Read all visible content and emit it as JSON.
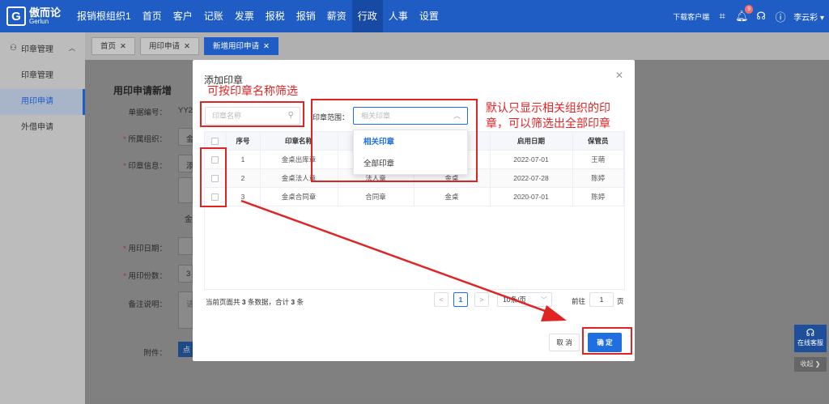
{
  "brand": {
    "logo_mark": "G",
    "name_cn": "傲而论",
    "name_en": "Gerlun"
  },
  "nav": {
    "items": [
      "报销根组织1",
      "首页",
      "客户",
      "记账",
      "发票",
      "报税",
      "报销",
      "薪资",
      "行政",
      "人事",
      "设置"
    ],
    "active": "行政"
  },
  "topbar": {
    "download": "下载客户端",
    "badge": "9",
    "user": "李云彩 ▾"
  },
  "sidebar": {
    "group": "印章管理",
    "items": [
      "印章管理",
      "用印申请",
      "外借申请"
    ],
    "active": "用印申请"
  },
  "tabs": [
    {
      "label": "首页",
      "active": false
    },
    {
      "label": "用印申请",
      "active": false
    },
    {
      "label": "新增用印申请",
      "active": true
    }
  ],
  "form": {
    "title": "用印申请新增",
    "labels": {
      "doc_no": "单据编号：",
      "org": "所属组织：",
      "seal_info": "印章信息：",
      "date": "用印日期：",
      "count": "用印份数：",
      "remark": "备注说明：",
      "attach": "附件："
    },
    "doc_no_value": "YY2",
    "org_value": "金",
    "seal_value": "添",
    "seal_sub": "金",
    "count_value": "3",
    "remark_value": "请",
    "attach_btn": "点"
  },
  "modal": {
    "title": "添加印章",
    "search_placeholder": "印章名称",
    "scope_label": "印章范围：",
    "scope_placeholder": "相关印章",
    "scope_options": [
      "相关印章",
      "全部印章"
    ],
    "scope_selected": "相关印章",
    "table": {
      "headers": [
        "序号",
        "印章名称",
        "",
        "",
        "",
        "启用日期",
        "保管员"
      ],
      "rows": [
        {
          "no": "1",
          "name": "金桌出库章",
          "type": "",
          "org": "",
          "date": "2022-07-01",
          "keeper": "王萌"
        },
        {
          "no": "2",
          "name": "金桌法人章",
          "type": "法人章",
          "org": "金桌",
          "date": "2022-07-28",
          "keeper": "陈婷"
        },
        {
          "no": "3",
          "name": "金桌合同章",
          "type": "合同章",
          "org": "金桌",
          "date": "2020-07-01",
          "keeper": "陈婷"
        }
      ]
    },
    "pager": {
      "prefix": "当前页面共",
      "count1": "3",
      "mid": "条数据，合计",
      "count2": "3",
      "suffix": "条",
      "prev": "<",
      "current": "1",
      "next": ">",
      "page_size": "10条/页",
      "goto_label": "前往",
      "goto_value": "1",
      "goto_unit": "页"
    },
    "cancel": "取 消",
    "confirm": "确 定"
  },
  "annotations": {
    "search_note": "可按印章名称筛选",
    "scope_note_line1": "默认只显示相关组织的印",
    "scope_note_line2": "章，可以筛选出全部印章"
  },
  "float": {
    "cs": "在线客服",
    "collapse": "收起 ❯"
  },
  "colors": {
    "primary": "#1f5cc4",
    "accent": "#1f6fe0",
    "annotation": "#e02424"
  }
}
